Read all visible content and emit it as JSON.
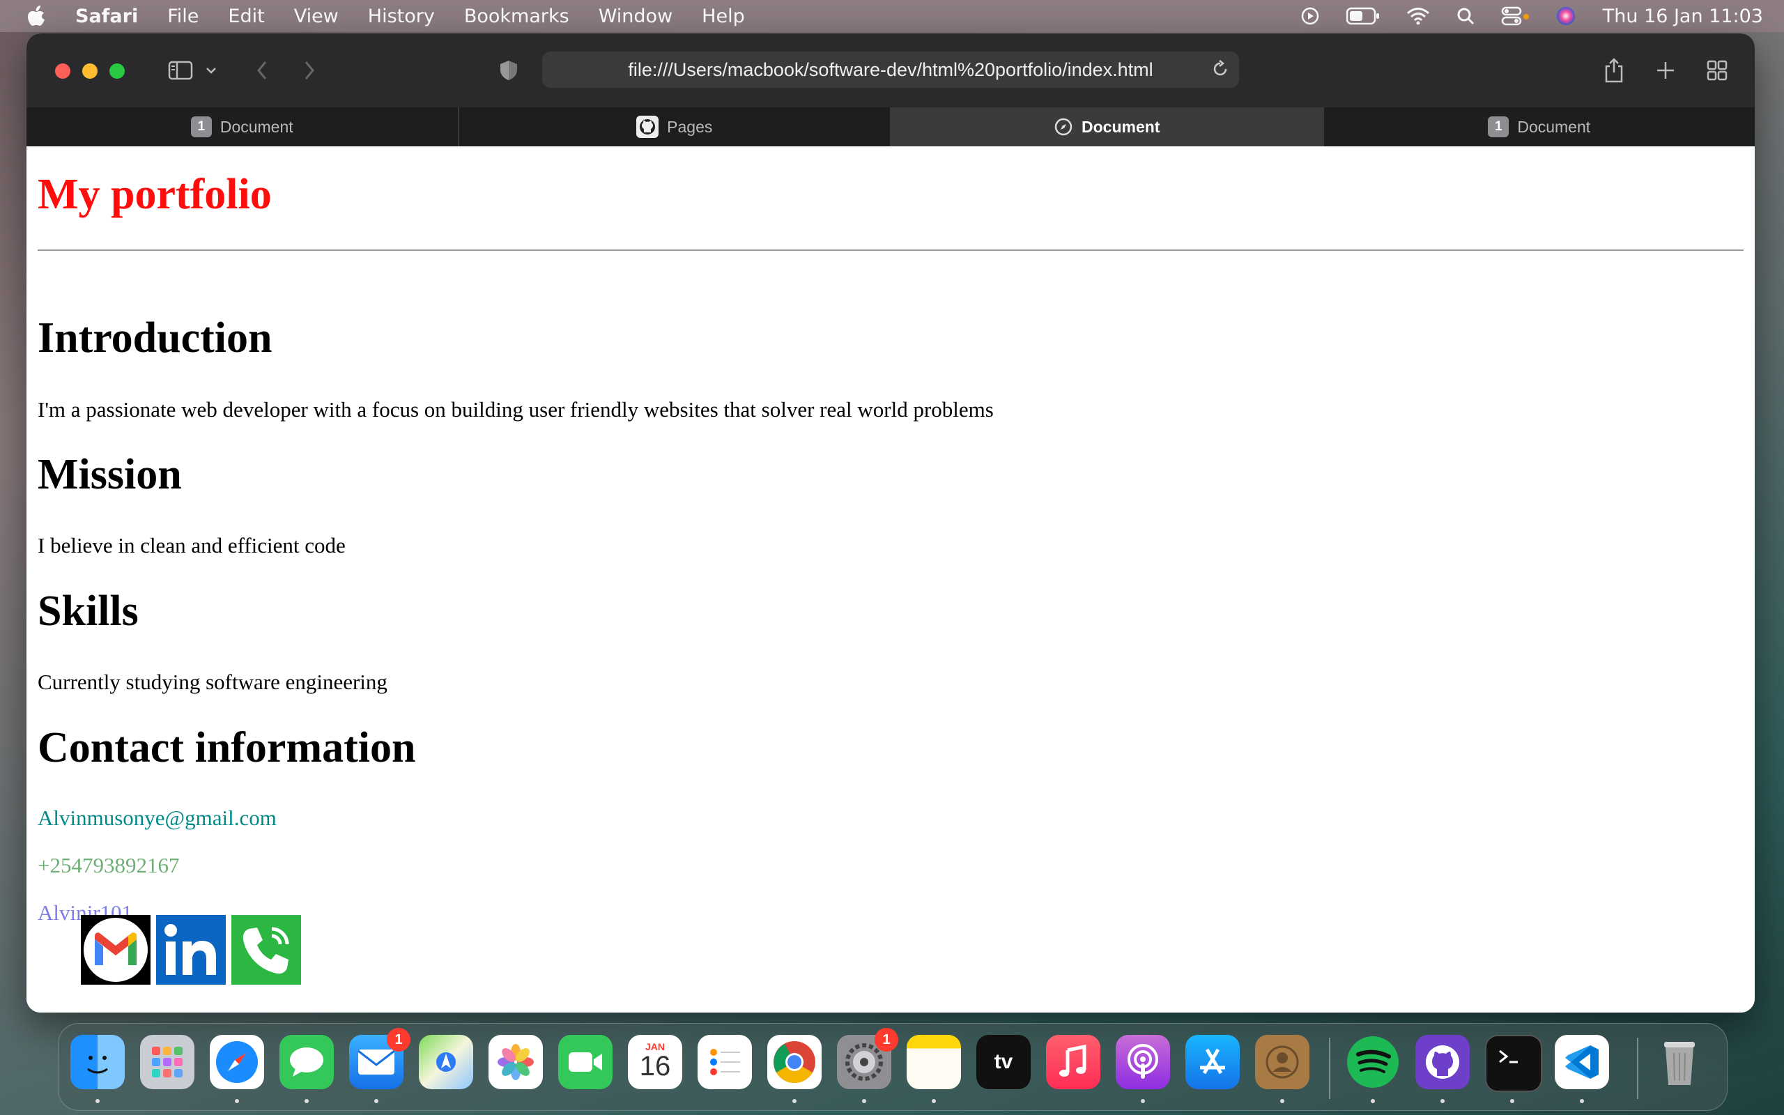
{
  "menubar": {
    "app_name": "Safari",
    "items": [
      "File",
      "Edit",
      "View",
      "History",
      "Bookmarks",
      "Window",
      "Help"
    ],
    "clock": "Thu 16 Jan  11:03",
    "status_icons": [
      "play-icon",
      "battery-icon",
      "wifi-icon",
      "search-icon",
      "control-center-icon",
      "siri-icon"
    ]
  },
  "browser": {
    "url": "file:///Users/macbook/software-dev/html%20portfolio/index.html",
    "tabs": [
      {
        "label": "Document",
        "badge": "1",
        "icon": "tab-number-badge",
        "active": false
      },
      {
        "label": "Pages",
        "icon": "github-icon",
        "active": false
      },
      {
        "label": "Document",
        "icon": "compass-icon",
        "active": true
      },
      {
        "label": "Document",
        "badge": "1",
        "icon": "tab-number-badge",
        "active": false
      }
    ]
  },
  "page": {
    "title": "My portfolio",
    "intro_heading": "Introduction",
    "intro_text": "I'm a passionate web developer with a focus on building user friendly websites that solver real world problems",
    "mission_heading": "Mission",
    "mission_text": "I believe in clean and efficient code",
    "skills_heading": "Skills",
    "skills_text": "Currently studying software engineering",
    "contact_heading": "Contact information",
    "email": "Alvinmusonye@gmail.com",
    "phone": "+254793892167",
    "handle": "Alvinjr101",
    "social_icons": [
      "gmail-icon",
      "linkedin-icon",
      "phone-icon"
    ],
    "colors": {
      "title": "#ff0d0d",
      "email": "#008b8b",
      "phone": "#6fae77",
      "handle": "#7d7de8"
    }
  },
  "dock": {
    "apps": [
      "Finder",
      "Launchpad",
      "Safari",
      "Messages",
      "Mail",
      "Maps",
      "Photos",
      "FaceTime",
      "Calendar",
      "Reminders",
      "Chrome",
      "System Settings",
      "Notes",
      "TV",
      "Music",
      "Podcasts",
      "App Store",
      "Contacts",
      "Spotify",
      "GitHub Desktop",
      "Terminal",
      "VS Code",
      "Trash"
    ],
    "mail_badge": "1",
    "settings_badge": "1",
    "calendar_month": "JAN",
    "calendar_day": "16",
    "tv_label": "tv"
  }
}
